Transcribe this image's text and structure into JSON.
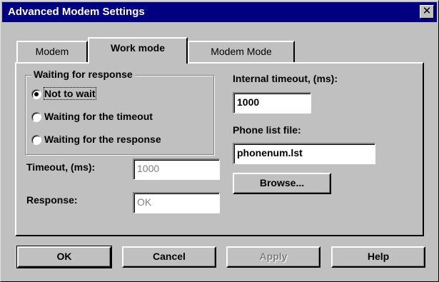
{
  "window": {
    "title": "Advanced Modem Settings",
    "close_glyph": "✕"
  },
  "tabs": [
    {
      "label": "Modem",
      "active": false
    },
    {
      "label": "Work mode",
      "active": true
    },
    {
      "label": "Modem Mode",
      "active": false
    }
  ],
  "waiting_group": {
    "legend": "Waiting for response",
    "options": [
      {
        "label": "Not to wait",
        "selected": true
      },
      {
        "label": "Waiting for the timeout",
        "selected": false
      },
      {
        "label": "Waiting for the response",
        "selected": false
      }
    ]
  },
  "timeout": {
    "label": "Timeout, (ms):",
    "value": "1000",
    "enabled": false
  },
  "response": {
    "label": "Response:",
    "value": "OK",
    "enabled": false
  },
  "internal_timeout": {
    "label": "Internal timeout, (ms):",
    "value": "1000"
  },
  "phone_list": {
    "label": "Phone list file:",
    "value": "phonenum.lst"
  },
  "browse_button": {
    "label": "Browse..."
  },
  "buttons": {
    "ok": "OK",
    "cancel": "Cancel",
    "apply": "Apply",
    "help": "Help"
  },
  "colors": {
    "titlebar": "#000080",
    "face": "#c0c0c0"
  }
}
